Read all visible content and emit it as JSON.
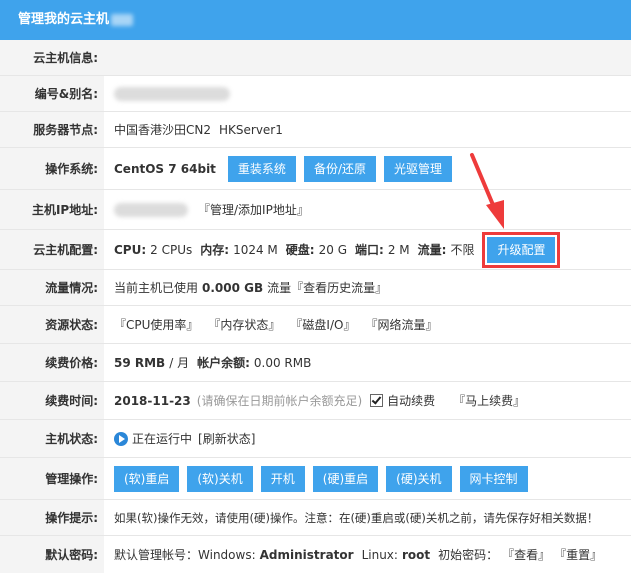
{
  "header": {
    "title": "管理我的云主机"
  },
  "rows": {
    "info": {
      "label": "云主机信息:"
    },
    "id_alias": {
      "label": "编号&别名:"
    },
    "node": {
      "label": "服务器节点:",
      "location": "中国香港沙田CN2",
      "server": "HKServer1"
    },
    "os": {
      "label": "操作系统:",
      "value": "CentOS 7 64bit",
      "buttons": [
        "重装系统",
        "备份/还原",
        "光驱管理"
      ]
    },
    "ip": {
      "label": "主机IP地址:",
      "manage_link": "『管理/添加IP地址』"
    },
    "config": {
      "label": "云主机配置:",
      "cpu_label": "CPU:",
      "cpu_value": "2 CPUs",
      "mem_label": "内存:",
      "mem_value": "1024 M",
      "disk_label": "硬盘:",
      "disk_value": "20 G",
      "port_label": "端口:",
      "port_value": "2 M",
      "traffic_label": "流量:",
      "traffic_value": "不限",
      "upgrade_button": "升级配置"
    },
    "traffic": {
      "label": "流量情况:",
      "prefix": "当前主机已使用",
      "used": "0.000 GB",
      "suffix": "流量",
      "history_link": "『查看历史流量』"
    },
    "resources": {
      "label": "资源状态:",
      "links": [
        "『CPU使用率』",
        "『内存状态』",
        "『磁盘I/O』",
        "『网络流量』"
      ]
    },
    "price": {
      "label": "续费价格:",
      "price": "59 RMB",
      "period": "/ 月",
      "balance_label": "帐户余额:",
      "balance": "0.00 RMB"
    },
    "renew_time": {
      "label": "续费时间:",
      "date": "2018-11-23",
      "note": "(请确保在日期前帐户余额充足)",
      "auto_renew": "自动续费",
      "renew_link": "『马上续费』"
    },
    "status": {
      "label": "主机状态:",
      "running": "正在运行中",
      "refresh_link": "[刷新状态]"
    },
    "operations": {
      "label": "管理操作:",
      "buttons": [
        "(软)重启",
        "(软)关机",
        "开机",
        "(硬)重启",
        "(硬)关机",
        "网卡控制"
      ]
    },
    "tip": {
      "label": "操作提示:",
      "text": "如果(软)操作无效，请使用(硬)操作。注意：在(硬)重启或(硬)关机之前，请先保存好相关数据！"
    },
    "password": {
      "label": "默认密码:",
      "account_prefix": "默认管理帐号：",
      "windows_label": "Windows:",
      "windows_user": "Administrator",
      "linux_label": "Linux:",
      "linux_user": "root",
      "init_pw_label": "初始密码：",
      "view_link": "『查看』",
      "reset_link": "『重置』"
    }
  },
  "colors": {
    "accent": "#3fa3ec",
    "highlight": "#ee3b3b",
    "label_bg": "#f4f4f4"
  }
}
